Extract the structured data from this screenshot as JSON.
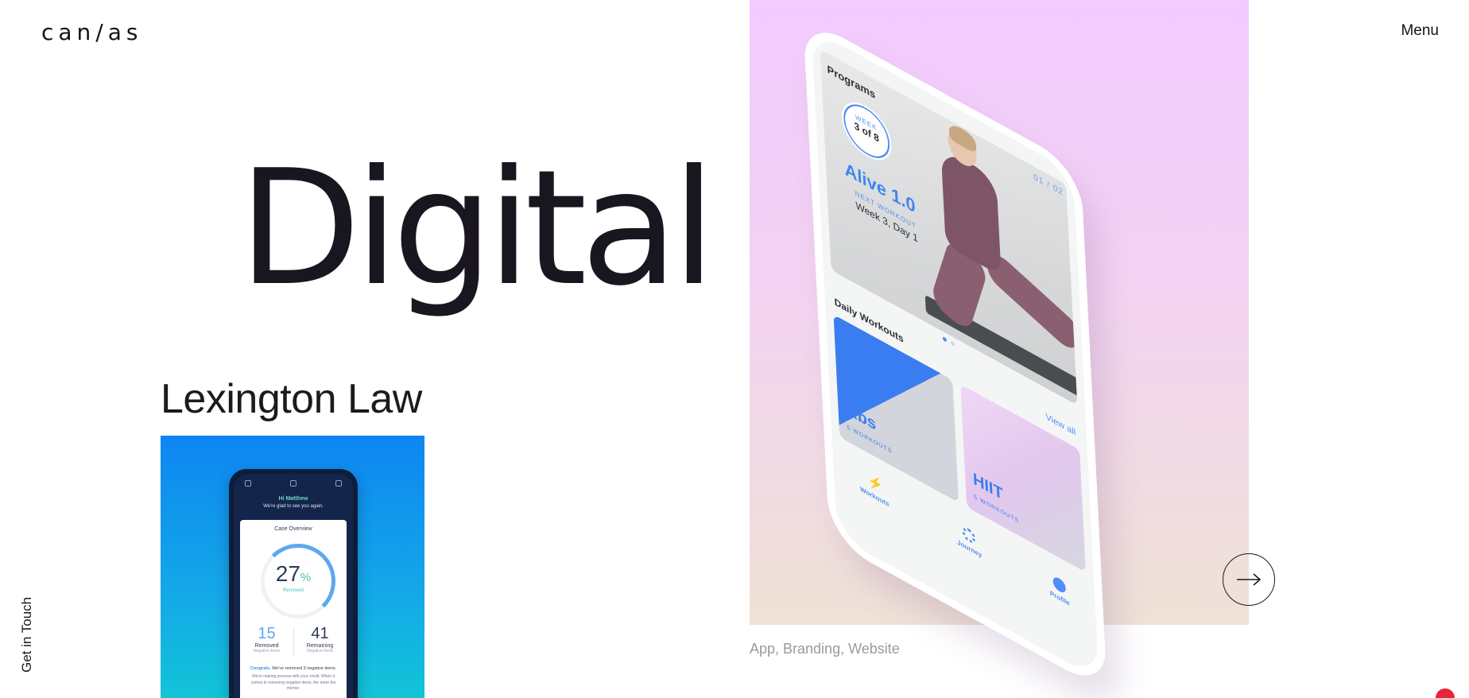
{
  "header": {
    "logo_text": "can/as",
    "menu_label": "Menu"
  },
  "hero": {
    "title": "Digital Pr"
  },
  "project": {
    "title": "Lexington Law",
    "thumb_phone": {
      "greeting": "Hi Matthew",
      "subtitle": "We're glad to see you again.",
      "card_title": "Case Overview",
      "percent": "27",
      "percent_sign": "%",
      "percent_label": "Removed",
      "stat_left_value": "15",
      "stat_left_label": "Removed",
      "stat_left_sub": "Negative items",
      "stat_right_value": "41",
      "stat_right_label": "Remaining",
      "stat_right_sub": "Negative items",
      "message_highlight": "Congrats.",
      "message_rest": "We've removed 3 negative items.",
      "message_body": "We're making process with your credit. When it comes to removing negative items, the more the merrier."
    }
  },
  "feature": {
    "tags": "App, Branding, Website",
    "colors": {
      "gradient_top": "#f2cbff",
      "gradient_bottom": "#efe2d6",
      "accent": "#4f8ef5"
    },
    "phone": {
      "programs_label": "Programs",
      "pager": "01 / 02",
      "week_label": "WEEK",
      "week_value": "3 of 8",
      "program_name": "Alive 1.0",
      "next_workout_label": "NEXT WORKOUT",
      "next_workout_value": "Week 3, Day 1",
      "daily_label": "Daily Workouts",
      "view_all": "View all",
      "card1_name": "Abs",
      "card1_sub": "5 WORKOUTS",
      "card2_name": "HIIT",
      "card2_sub": "5 WORKOUTS",
      "nav_workouts": "Workouts",
      "nav_journey": "Journey",
      "nav_profile": "Profile"
    }
  },
  "side": {
    "get_in_touch": "Get in Touch"
  },
  "icons": {
    "next": "arrow-right-icon",
    "chat": "chat-bubble-icon"
  }
}
